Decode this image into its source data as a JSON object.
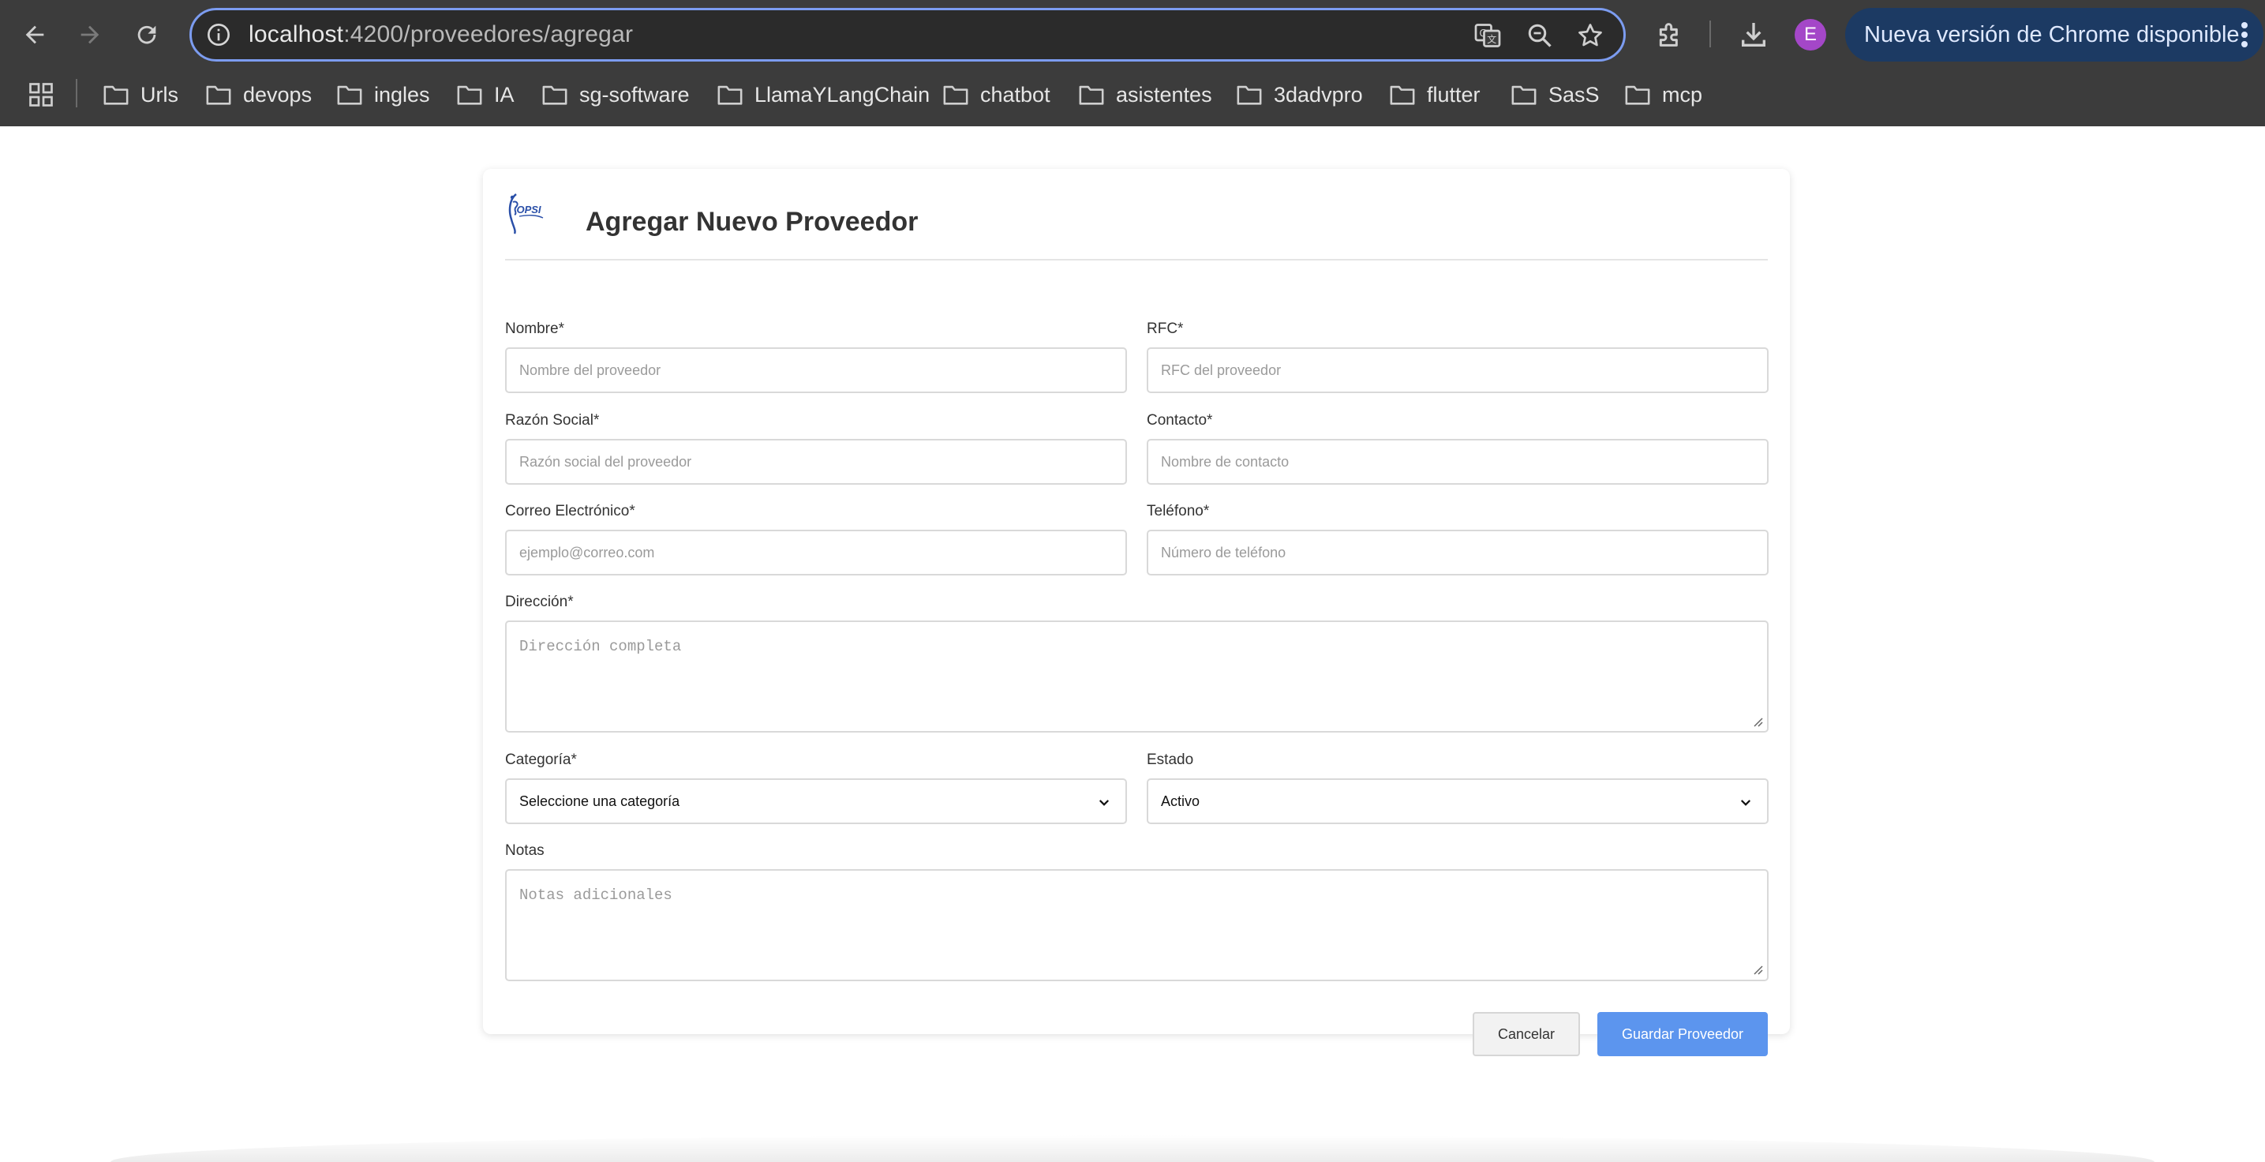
{
  "browser": {
    "url_host": "localhost",
    "url_rest": ":4200/proveedores/agregar",
    "profile_initial": "E",
    "update_label": "Nueva versión de Chrome disponible",
    "bookmarks": [
      "Urls",
      "devops",
      "ingles",
      "IA",
      "sg-software",
      "LlamaYLangChain",
      "chatbot",
      "asistentes",
      "3dadvpro",
      "flutter",
      "SasS",
      "mcp"
    ]
  },
  "form": {
    "title": "Agregar Nuevo Proveedor",
    "logo_text": "OPSI",
    "nombre": {
      "label": "Nombre*",
      "placeholder": "Nombre del proveedor",
      "value": ""
    },
    "rfc": {
      "label": "RFC*",
      "placeholder": "RFC del proveedor",
      "value": ""
    },
    "razon_social": {
      "label": "Razón Social*",
      "placeholder": "Razón social del proveedor",
      "value": ""
    },
    "contacto": {
      "label": "Contacto*",
      "placeholder": "Nombre de contacto",
      "value": ""
    },
    "correo": {
      "label": "Correo Electrónico*",
      "placeholder": "ejemplo@correo.com",
      "value": ""
    },
    "telefono": {
      "label": "Teléfono*",
      "placeholder": "Número de teléfono",
      "value": ""
    },
    "direccion": {
      "label": "Dirección*",
      "placeholder": "Dirección completa",
      "value": ""
    },
    "categoria": {
      "label": "Categoría*",
      "selected": "Seleccione una categoría"
    },
    "estado": {
      "label": "Estado",
      "selected": "Activo"
    },
    "notas": {
      "label": "Notas",
      "placeholder": "Notas adicionales",
      "value": ""
    },
    "cancel_label": "Cancelar",
    "save_label": "Guardar Proveedor"
  },
  "colors": {
    "primary_button": "#5c95ee",
    "chrome_background": "#3c3c3c",
    "omnibox_focus": "#7c9cf0",
    "avatar": "#a447c8"
  }
}
